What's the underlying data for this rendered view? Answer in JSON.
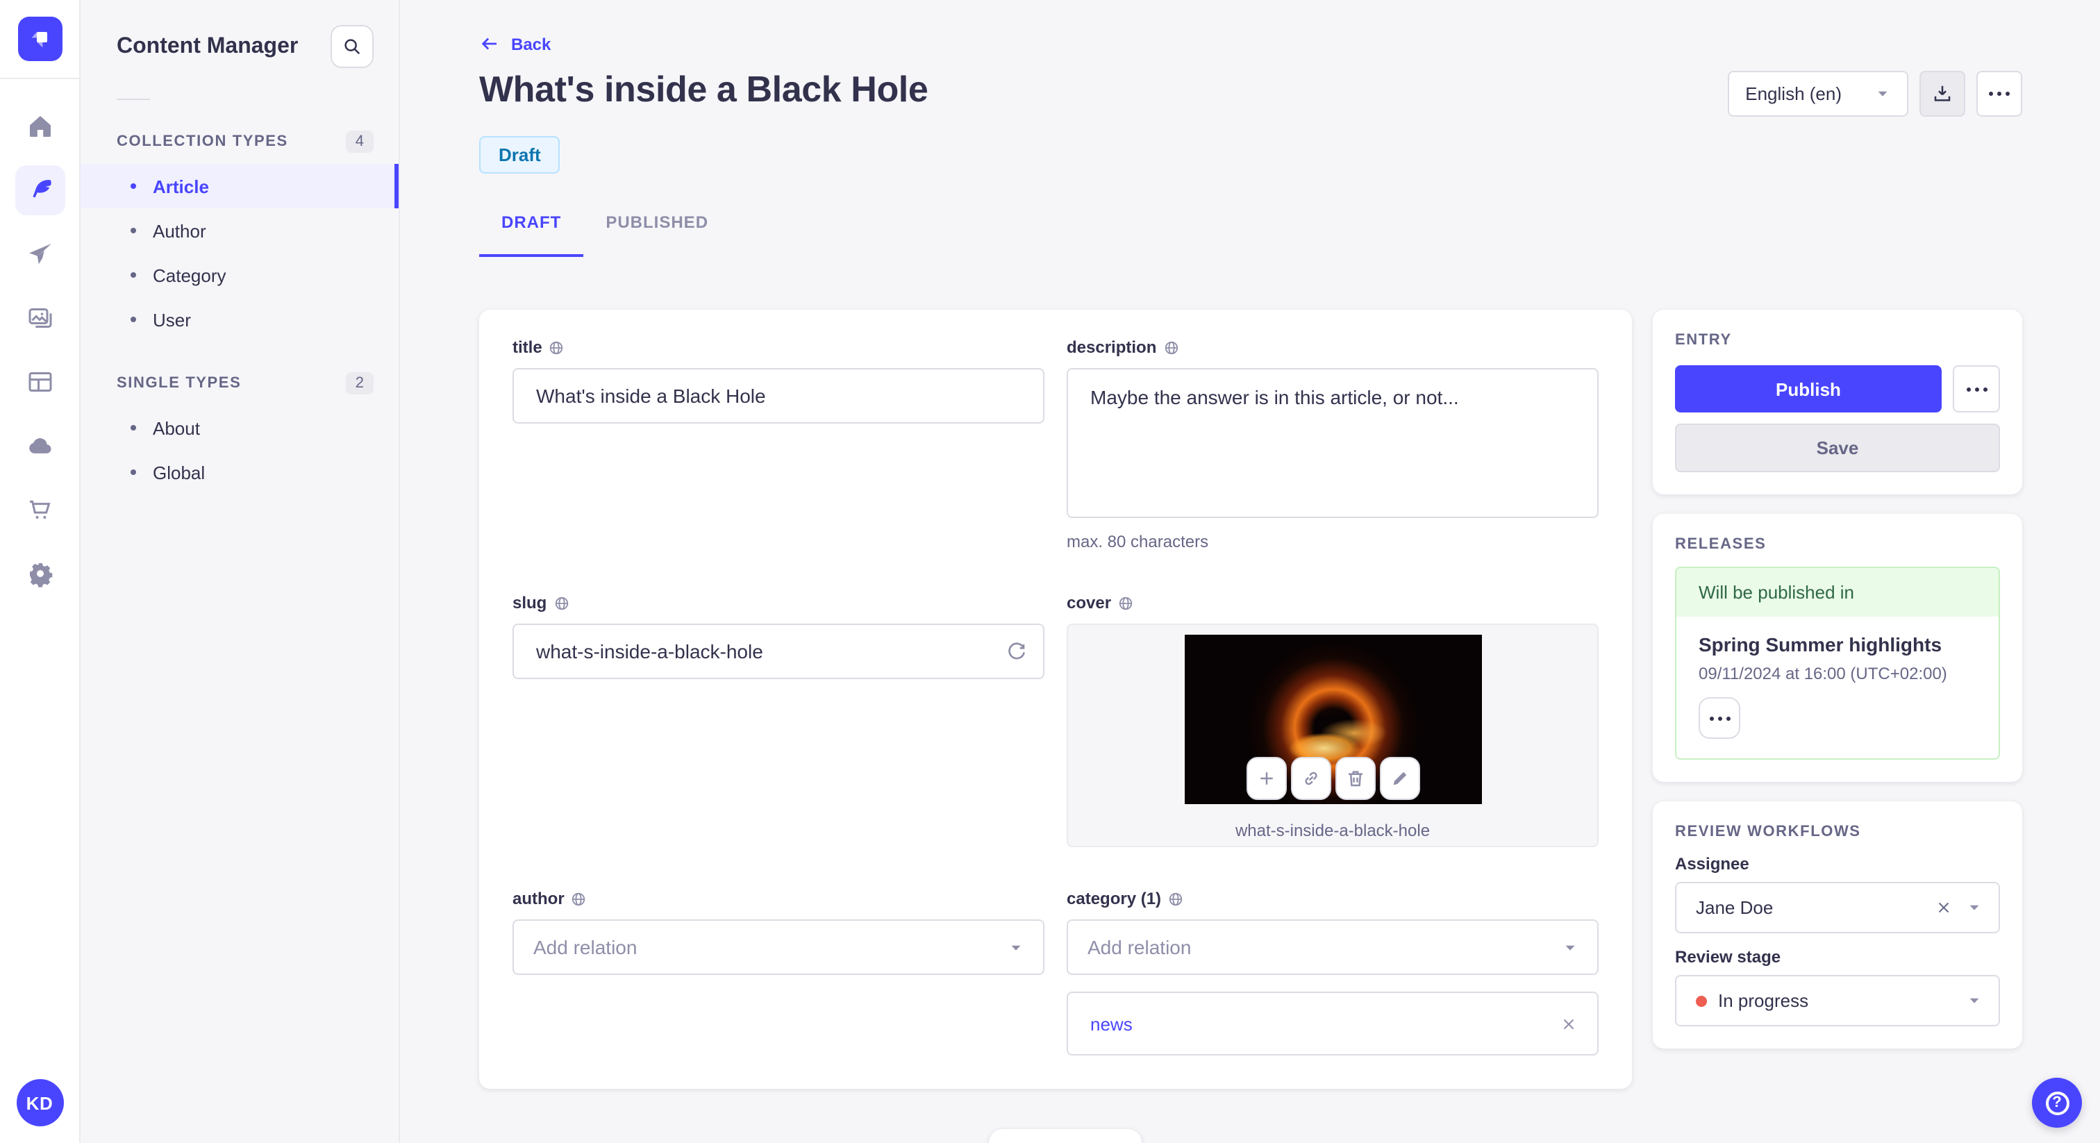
{
  "colors": {
    "primary": "#4945FF",
    "primary_light": "#F0F0FF",
    "background": "#F6F6F9",
    "surface": "#FFFFFF",
    "text": "#32324D",
    "text_muted": "#666687",
    "border": "#DCDCE4",
    "draft_badge_text": "#0C75AF",
    "draft_badge_bg": "#EAF5FF",
    "success_text": "#2F6846",
    "success_bg": "#EAFBE7",
    "danger_dot": "#EE5E52"
  },
  "nav_rail": {
    "logo_icon": "strapi-logo",
    "icons": [
      "home-icon",
      "feather-icon",
      "send-icon",
      "media-icon",
      "layout-icon",
      "cloud-icon",
      "cart-icon",
      "gear-icon"
    ],
    "active_icon": "feather-icon",
    "avatar_initials": "KD"
  },
  "subnav": {
    "title": "Content Manager",
    "search_icon": "search-icon",
    "sections": [
      {
        "label": "COLLECTION TYPES",
        "count": "4",
        "items": [
          {
            "label": "Article",
            "active": true
          },
          {
            "label": "Author"
          },
          {
            "label": "Category"
          },
          {
            "label": "User"
          }
        ]
      },
      {
        "label": "SINGLE TYPES",
        "count": "2",
        "items": [
          {
            "label": "About"
          },
          {
            "label": "Global"
          }
        ]
      }
    ]
  },
  "header": {
    "back_label": "Back",
    "title": "What's inside a Black Hole",
    "status_badge": "Draft",
    "locale_selected": "English (en)"
  },
  "tabs": [
    {
      "label": "DRAFT",
      "active": true
    },
    {
      "label": "PUBLISHED",
      "active": false
    }
  ],
  "form": {
    "title": {
      "label": "title",
      "value": "What's inside a Black Hole"
    },
    "description": {
      "label": "description",
      "value": "Maybe the answer is in this article, or not...",
      "hint": "max. 80 characters"
    },
    "slug": {
      "label": "slug",
      "value": "what-s-inside-a-black-hole",
      "action_icon": "regenerate-icon"
    },
    "cover": {
      "label": "cover",
      "caption": "what-s-inside-a-black-hole",
      "action_icons": [
        "add-icon",
        "link-icon",
        "delete-icon",
        "edit-icon"
      ]
    },
    "author": {
      "label": "author",
      "placeholder": "Add relation"
    },
    "category": {
      "label": "category (1)",
      "placeholder": "Add relation",
      "tags": [
        {
          "label": "news"
        }
      ]
    }
  },
  "entry_panel": {
    "heading": "ENTRY",
    "publish_label": "Publish",
    "save_label": "Save"
  },
  "releases_panel": {
    "heading": "RELEASES",
    "status": "Will be published in",
    "release_name": "Spring Summer highlights",
    "release_date": "09/11/2024 at 16:00 (UTC+02:00)"
  },
  "review_panel": {
    "heading": "REVIEW WORKFLOWS",
    "assignee_label": "Assignee",
    "assignee_value": "Jane Doe",
    "stage_label": "Review stage",
    "stage_value": "In progress"
  }
}
